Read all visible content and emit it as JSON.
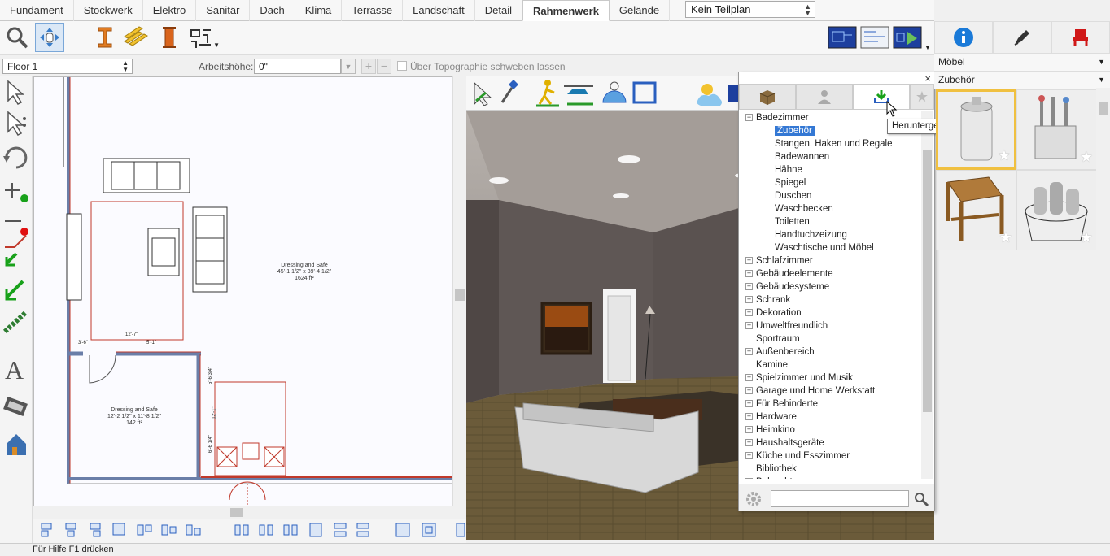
{
  "menu_tabs": [
    "Fundament",
    "Stockwerk",
    "Elektro",
    "Sanitär",
    "Dach",
    "Klima",
    "Terrasse",
    "Landschaft",
    "Detail",
    "Rahmenwerk",
    "Gelände"
  ],
  "active_tab": "Rahmenwerk",
  "plan_selector": {
    "value": "Kein Teilplan"
  },
  "floor_selector": {
    "value": "Floor 1"
  },
  "working_height": {
    "label": "Arbeitshöhe:",
    "value": "0\""
  },
  "topography_checkbox": {
    "label": "Über Topographie schweben lassen",
    "checked": false
  },
  "plan": {
    "room1": {
      "name": "Dressing and Safe",
      "dims": "45'-1 1/2\" x 39'-4 1/2\"",
      "area": "1624 ft²"
    },
    "room2": {
      "name": "Dressing and Safe",
      "dims": "12'-2 1/2\" x 11'-8 1/2\"",
      "area": "142 ft²"
    },
    "dim_labels": [
      "12'-7\"",
      "5'-1\"",
      "3'-6\"",
      "5'-6 3/4\"",
      "12'-1\"",
      "6'-6 1/4\""
    ]
  },
  "library": {
    "close": "×",
    "tree": [
      {
        "label": "Badezimmer",
        "expanded": true,
        "children": [
          {
            "label": "Zubehör",
            "selected": true
          },
          {
            "label": "Stangen, Haken und Regale"
          },
          {
            "label": "Badewannen"
          },
          {
            "label": "Hähne"
          },
          {
            "label": "Spiegel"
          },
          {
            "label": "Duschen"
          },
          {
            "label": "Waschbecken"
          },
          {
            "label": "Toiletten"
          },
          {
            "label": "Handtuchzeizung"
          },
          {
            "label": "Waschtische und Möbel"
          }
        ]
      },
      {
        "label": "Schlafzimmer",
        "expandable": true
      },
      {
        "label": "Gebäudeelemente",
        "expandable": true
      },
      {
        "label": "Gebäudesysteme",
        "expandable": true
      },
      {
        "label": "Schrank",
        "expandable": true
      },
      {
        "label": "Dekoration",
        "expandable": true
      },
      {
        "label": "Umweltfreundlich",
        "expandable": true
      },
      {
        "label": "Sportraum",
        "expandable": false
      },
      {
        "label": "Außenbereich",
        "expandable": true
      },
      {
        "label": "Kamine",
        "expandable": false
      },
      {
        "label": "Spielzimmer und Musik",
        "expandable": true
      },
      {
        "label": "Garage und Home Werkstatt",
        "expandable": true
      },
      {
        "label": "Für Behinderte",
        "expandable": true
      },
      {
        "label": "Hardware",
        "expandable": true
      },
      {
        "label": "Heimkino",
        "expandable": true
      },
      {
        "label": "Haushaltsgeräte",
        "expandable": true
      },
      {
        "label": "Küche und Esszimmer",
        "expandable": true
      },
      {
        "label": "Bibliothek",
        "expandable": false
      },
      {
        "label": "Beleuchtung",
        "expandable": true
      }
    ],
    "search": {
      "value": ""
    },
    "tooltip": "Heruntergeladene Bibliotheksobjekte anzeigen"
  },
  "right_panel": {
    "category": "Möbel",
    "subcategory": "Zubehör",
    "thumbnails": [
      "bathroom-canister",
      "toothbrush-holder",
      "corner-table",
      "towel-basket"
    ]
  },
  "status_bar": "Für Hilfe F1 drücken",
  "colors": {
    "accent": "#3478d4",
    "wall_red": "#c0392b",
    "wall_blue": "#6a7ea8",
    "selected_border": "#f0c040"
  }
}
